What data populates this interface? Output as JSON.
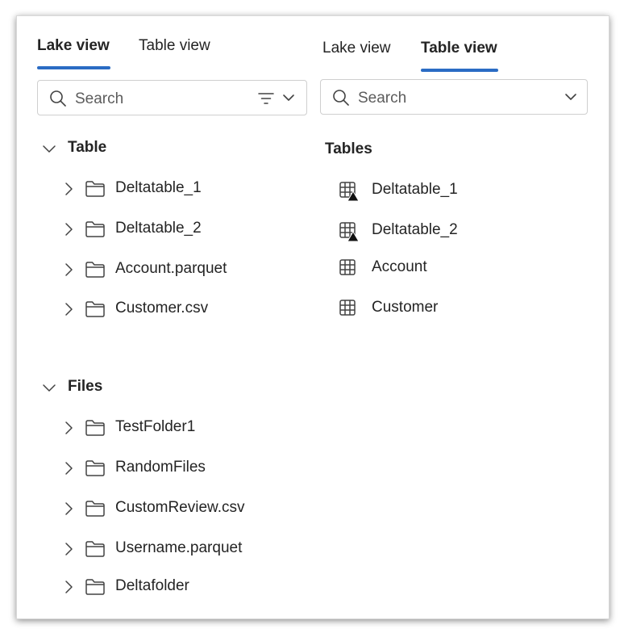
{
  "lake_panel": {
    "tabs": [
      {
        "label": "Lake view",
        "active": true
      },
      {
        "label": "Table view",
        "active": false
      }
    ],
    "search_placeholder": "Search",
    "sections": [
      {
        "title": "Table",
        "items": [
          "Deltatable_1",
          "Deltatable_2",
          "Account.parquet",
          "Customer.csv"
        ]
      },
      {
        "title": "Files",
        "items": [
          "TestFolder1",
          "RandomFiles",
          "CustomReview.csv",
          "Username.parquet",
          "Deltafolder"
        ]
      }
    ]
  },
  "table_panel": {
    "tabs": [
      {
        "label": "Lake view",
        "active": false
      },
      {
        "label": "Table view",
        "active": true
      }
    ],
    "search_placeholder": "Search",
    "section_title": "Tables",
    "items": [
      {
        "label": "Deltatable_1",
        "icon": "delta-table-icon"
      },
      {
        "label": "Deltatable_2",
        "icon": "delta-table-icon"
      },
      {
        "label": "Account",
        "icon": "table-icon"
      },
      {
        "label": "Customer",
        "icon": "table-icon"
      }
    ]
  },
  "colors": {
    "accent": "#2b6cc4",
    "text": "#242424",
    "placeholder": "#5c5c5c",
    "border": "#cfcfcf"
  }
}
